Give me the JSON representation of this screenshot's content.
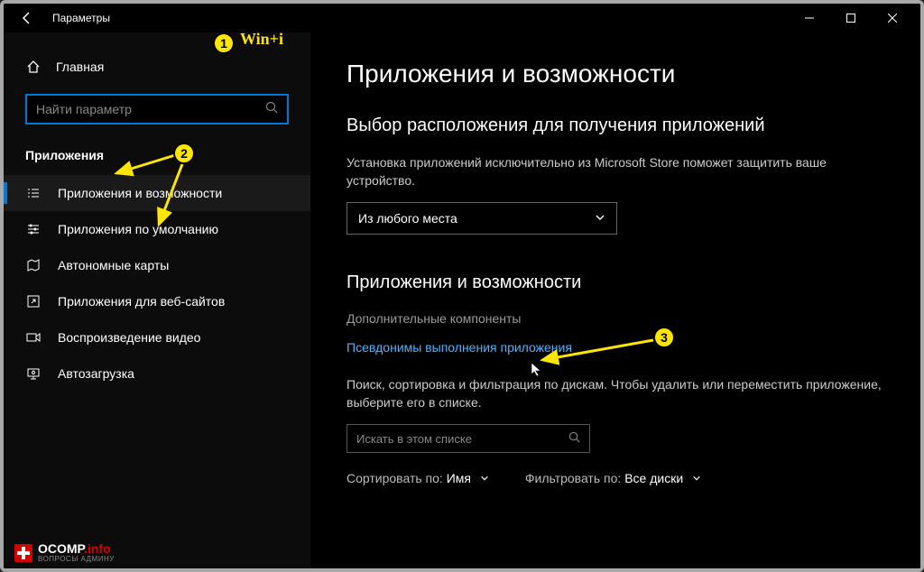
{
  "window": {
    "title": "Параметры"
  },
  "annotations": {
    "badge1_text": "Win+i"
  },
  "sidebar": {
    "home_label": "Главная",
    "search_placeholder": "Найти параметр",
    "section_label": "Приложения",
    "items": [
      {
        "label": "Приложения и возможности"
      },
      {
        "label": "Приложения по умолчанию"
      },
      {
        "label": "Автономные карты"
      },
      {
        "label": "Приложения для веб-сайтов"
      },
      {
        "label": "Воспроизведение видео"
      },
      {
        "label": "Автозагрузка"
      }
    ]
  },
  "content": {
    "h1": "Приложения и возможности",
    "h2_a": "Выбор расположения для получения приложений",
    "desc_a": "Установка приложений исключительно из Microsoft Store поможет защитить ваше устройство.",
    "dropdown_value": "Из любого места",
    "h2_b": "Приложения и возможности",
    "link_gray": "Дополнительные компоненты",
    "link_blue": "Псевдонимы выполнения приложения",
    "desc_b": "Поиск, сортировка и фильтрация по дискам. Чтобы удалить или переместить приложение, выберите его в списке.",
    "filter_search_placeholder": "Искать в этом списке",
    "sort_label": "Сортировать по:",
    "sort_value": "Имя",
    "filter_label": "Фильтровать по:",
    "filter_value": "Все диски"
  },
  "watermark": {
    "main_a": "OCOMP",
    "main_b": ".info",
    "sub": "ВОПРОСЫ АДМИНУ"
  }
}
